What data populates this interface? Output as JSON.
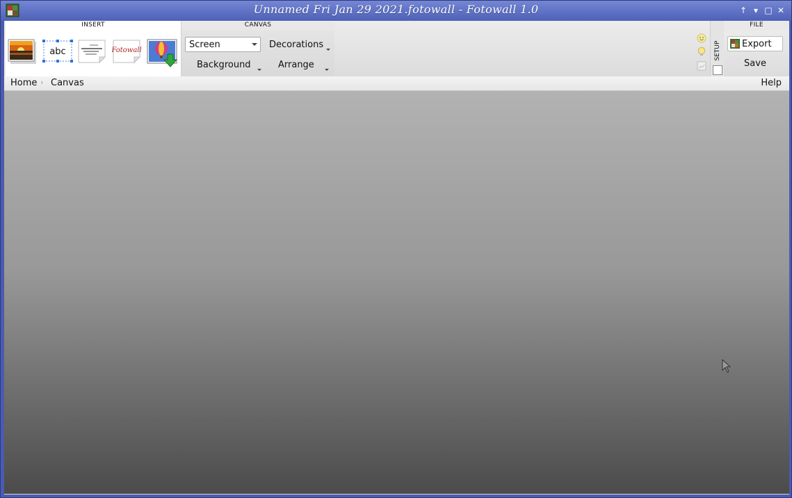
{
  "window": {
    "title": "Unnamed Fri Jan 29 2021.fotowall - Fotowall 1.0",
    "controls": {
      "pin": "↑",
      "minimize": "▾",
      "maximize": "□",
      "close": "✕"
    }
  },
  "ribbon": {
    "insert": {
      "title": "INSERT",
      "items": [
        {
          "icon": "photo-sunset-icon"
        },
        {
          "icon": "text-abc-icon",
          "text": "abc"
        },
        {
          "icon": "wordcloud-icon"
        },
        {
          "icon": "fotowall-webcam-icon",
          "text": "Fotowall"
        },
        {
          "icon": "download-balloon-icon"
        }
      ]
    },
    "canvas": {
      "title": "CANVAS",
      "mode_selected": "Screen",
      "decorations_label": "Decorations",
      "background_label": "Background",
      "arrange_label": "Arrange"
    },
    "tips": [
      "smiley-icon",
      "lightbulb-icon",
      "image-placeholder-icon"
    ],
    "setup": {
      "label": "SETUP"
    },
    "file": {
      "title": "FILE",
      "export_label": "Export",
      "save_label": "Save"
    }
  },
  "breadcrumb": {
    "home": "Home",
    "separator": "›",
    "current": "Canvas",
    "help": "Help"
  },
  "colors": {
    "titlebar": "#5366bd",
    "ribbon": "#eaeaea",
    "stage_top": "#b2b2b2",
    "stage_bottom": "#4b4b4b"
  }
}
